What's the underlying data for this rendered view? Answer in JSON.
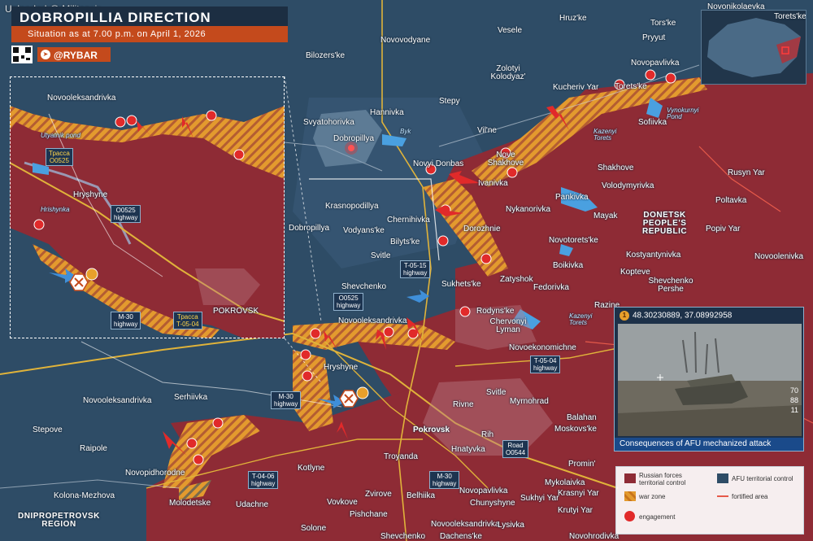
{
  "watermark": "Uploaded @ Military.ir",
  "header": {
    "title": "DOBROPILLIA DIRECTION",
    "subtitle": "Situation as at 7.00 p.m. on April 1, 2026",
    "brand": "@RYBAR"
  },
  "colors": {
    "russian_control": "#8e2b35",
    "afu_control": "#2e4c66",
    "war_zone": "#e39a2e",
    "accent": "#c44a1c",
    "engagement": "#e12a2a"
  },
  "regions": {
    "donetsk": "DONETSK\nPEOPLE'S\nREPUBLIC",
    "dnipro": "DNIPROPETROVSK\nREGION"
  },
  "settlements": [
    "Novonikolaevka",
    "Torets'ke",
    "Tors'ke",
    "Pryyut",
    "Novopavlivka",
    "Hruz'ke",
    "Vesele",
    "Novovodyane",
    "Bilozers'ke",
    "Zolotyi Kolodyaz'",
    "Kucheriv Yar",
    "Torets'ke",
    "Sofiivka",
    "Stepy",
    "Hannivka",
    "Svyatohorivka",
    "Dobropillya",
    "Vil'ne",
    "Nove Shakhove",
    "Shakhove",
    "Novyi Donbas",
    "Ivanivka",
    "Rusyn Yar",
    "Pankivka",
    "Volodymyrivka",
    "Poltavka",
    "Krasnopodillya",
    "Chernihivka",
    "Nykanorivka",
    "Mayak",
    "Dobropillya",
    "Vodyans'ke",
    "Dorozhnie",
    "Popiv Yar",
    "Bilyts'ke",
    "Novotorets'ke",
    "Svitle",
    "Boikivka",
    "Novoolenivka",
    "Shevchenko",
    "Zatyshok",
    "Fedorivka",
    "Kostyantynivka",
    "Sukhets'ke",
    "Kopteve",
    "Shevchenko Pershe",
    "Razine",
    "Novooleksandrivka",
    "Rodyns'ke",
    "Chervonyi Lyman",
    "Hryshyne",
    "Novoekonomichne",
    "Svitle",
    "Myrnohrad",
    "Novooleksandrivka",
    "Serhiivka",
    "Rivne",
    "Stepove",
    "Balahan",
    "Pokrovsk",
    "Rih",
    "Moskovs'ke",
    "Raipole",
    "Hnatyvka",
    "Troyanda",
    "Promin'",
    "Novopidhorodne",
    "Kotlyne",
    "Kolona-Mezhova",
    "Molodetske",
    "Udachne",
    "Zvirove",
    "Mykolaivka",
    "Novopavlivka",
    "Krasnyi Yar",
    "Vovkove",
    "Belhiika",
    "Chunyshyne",
    "Sukhyi Yar",
    "Pishchane",
    "Krutyi Yar",
    "Solone",
    "Novooleksandrivka",
    "Lysivka",
    "Shevchenko",
    "Dachens'ke",
    "Novohrodivka"
  ],
  "water_labels": [
    "Byk",
    "Kazenyi Torets",
    "Vynokurnyi Pond",
    "Kazenyi Torets",
    "Utyatnik pond",
    "Hrishynka"
  ],
  "roads": {
    "t0515": "T-05-15\nhighway",
    "o0525_main": "O0525\nhighway",
    "t0504": "T-05-04\nhighway",
    "m30_a": "M-30\nhighway",
    "m30_b": "M-30\nhighway",
    "t0406": "T-04-06\nhighway",
    "o0544": "Road\nO0544"
  },
  "inset": {
    "labels": [
      "Novooleksandrivka",
      "Hryshyne",
      "POKROVSK"
    ],
    "water": [
      "Utyatnik pond",
      "Hrishynka"
    ],
    "roads": {
      "trassa1": "Трасса\nO0525",
      "o0525": "O0525\nhighway",
      "m30": "M-30\nhighway",
      "trassa2": "Трасса\nT-05-04"
    }
  },
  "photo": {
    "coords": "48.30230889, 37.08992958",
    "badge": "1",
    "caption": "Consequences of AFU mechanized attack",
    "side_numbers": [
      "70",
      "88",
      "11"
    ]
  },
  "legend": {
    "russian": "Russian forces\nterritorial control",
    "afu": "AFU territorial control",
    "war_zone": "war zone",
    "fortified": "fortified area",
    "engagement": "engagement"
  },
  "icons": [
    "telegram-icon",
    "qr-code-icon",
    "engagement-icon",
    "attack-arrow-icon",
    "destroyed-vehicle-icon",
    "photo-marker-icon",
    "city-marker-icon"
  ]
}
